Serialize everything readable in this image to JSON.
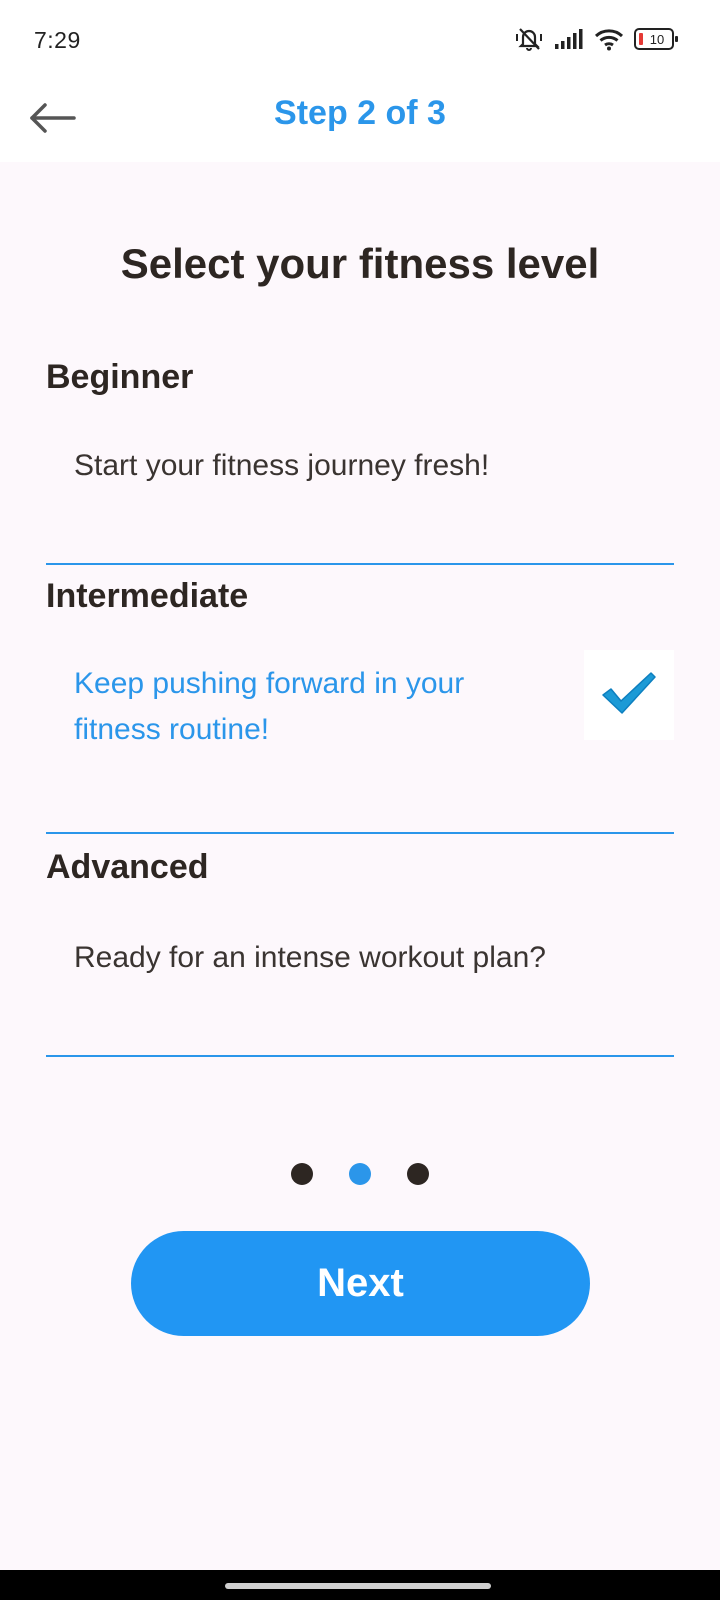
{
  "status_bar": {
    "time": "7:29",
    "battery_level": "10",
    "icons": [
      "mute-icon",
      "signal-icon",
      "wifi-icon",
      "battery-icon"
    ]
  },
  "app_bar": {
    "title": "Step 2 of 3",
    "back_icon": "arrow-left-icon"
  },
  "page": {
    "title": "Select your fitness level"
  },
  "levels": [
    {
      "name": "Beginner",
      "description": "Start your fitness journey fresh!",
      "selected": false
    },
    {
      "name": "Intermediate",
      "description": "Keep pushing forward in your fitness routine!",
      "selected": true
    },
    {
      "name": "Advanced",
      "description": "Ready for an intense workout plan?",
      "selected": false
    }
  ],
  "indicator": {
    "total": 3,
    "current": 2
  },
  "actions": {
    "next_label": "Next"
  },
  "colors": {
    "accent": "#2196f3",
    "title_accent": "#2b96ea",
    "text_dark": "#2d2622",
    "background": "#fdf8fc"
  }
}
